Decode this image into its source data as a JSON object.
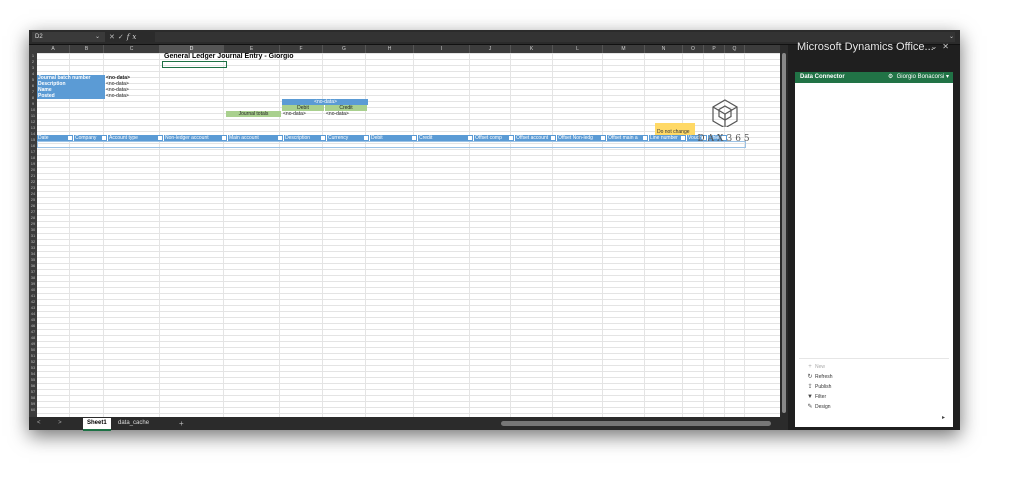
{
  "formula_bar": {
    "name_box": "D2",
    "fx_label": "fx",
    "cancel": "✕",
    "confirm": "✓"
  },
  "columns": [
    "A",
    "B",
    "C",
    "D",
    "E",
    "F",
    "G",
    "H",
    "I",
    "J",
    "K",
    "L",
    "M",
    "N",
    "O",
    "P",
    "Q"
  ],
  "rows": [
    "1",
    "2",
    "3",
    "4",
    "5",
    "6",
    "7",
    "8",
    "9",
    "10",
    "11",
    "12",
    "13",
    "14",
    "15",
    "16",
    "17",
    "18",
    "19",
    "20",
    "21",
    "22",
    "23",
    "24",
    "25",
    "26",
    "27",
    "28",
    "29",
    "30",
    "31",
    "32",
    "33",
    "34",
    "35",
    "36",
    "37",
    "38",
    "39",
    "40",
    "41",
    "42",
    "43",
    "44",
    "45",
    "46",
    "47",
    "48",
    "49",
    "50",
    "51",
    "52",
    "53",
    "54",
    "55",
    "56",
    "57",
    "58",
    "59",
    "60"
  ],
  "sheet": {
    "title": "General Ledger Journal Entry - Giorgio",
    "labels": {
      "batch": "Journal batch number",
      "description": "Description",
      "name": "Name",
      "posted": "Posted"
    },
    "values": {
      "batch": "<no-data>",
      "description": "<no-data>",
      "name": "<no-data>",
      "posted": "<no-data>"
    },
    "totals": {
      "group_header": "<no-data>",
      "debit_label": "Debit",
      "credit_label": "Credit",
      "row_label": "Journal totals",
      "debit_value": "<no-data>",
      "credit_value": "<no-data>"
    },
    "do_not_change": "Do not change",
    "table_headers": [
      "Date",
      "Company",
      "Account type",
      "Non-ledger account",
      "Main account",
      "Description",
      "Currency",
      "Debit",
      "Credit",
      "Offset comp",
      "Offset account",
      "Offset Non-ledg",
      "Offset main a",
      "Line number",
      "Vouch",
      "Chlem"
    ]
  },
  "logo": {
    "text": "DAX365"
  },
  "tabs": {
    "nav": "< >",
    "sheet1": "Sheet1",
    "data_cache": "data_cache",
    "add": "+"
  },
  "pane": {
    "title": "Microsoft Dynamics Office...",
    "header_title": "Data Connector",
    "user": "Giorgio Bonacorsi",
    "actions": {
      "new": "New",
      "refresh": "Refresh",
      "publish": "Publish",
      "filter": "Filter",
      "design": "Design"
    }
  }
}
